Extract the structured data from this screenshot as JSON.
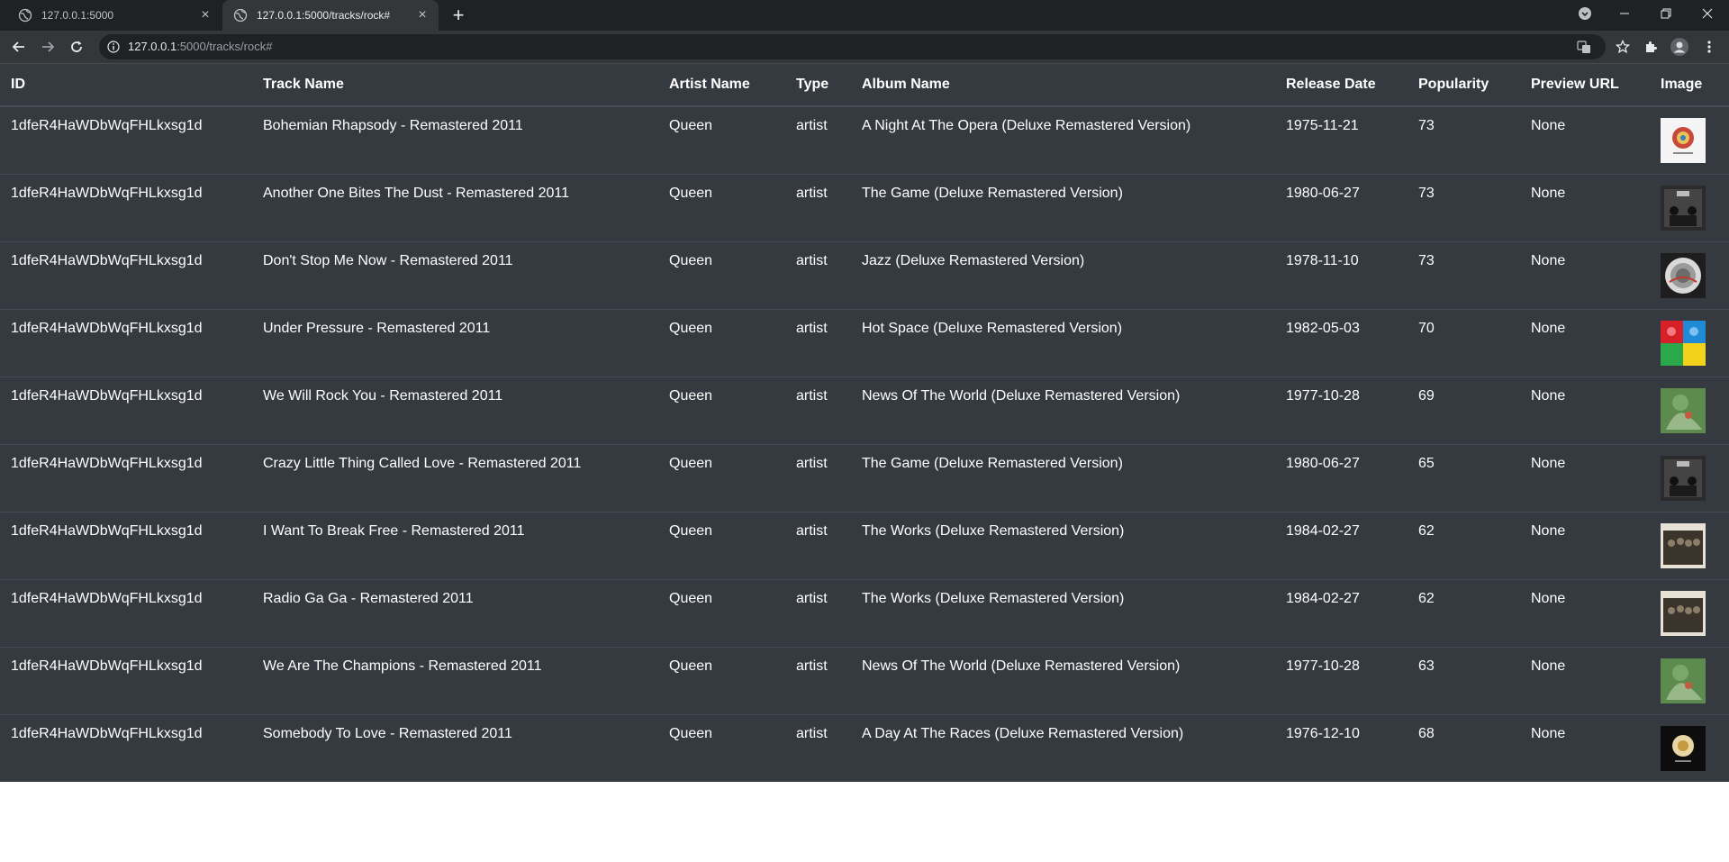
{
  "browser": {
    "tabs": [
      {
        "title": "127.0.0.1:5000",
        "active": false
      },
      {
        "title": "127.0.0.1:5000/tracks/rock#",
        "active": true
      }
    ],
    "address": {
      "host": "127.0.0.1",
      "path": ":5000/tracks/rock#"
    }
  },
  "table": {
    "headers": [
      "ID",
      "Track Name",
      "Artist Name",
      "Type",
      "Album Name",
      "Release Date",
      "Popularity",
      "Preview URL",
      "Image"
    ],
    "rows": [
      {
        "id": "1dfeR4HaWDbWqFHLkxsg1d",
        "track": "Bohemian Rhapsody - Remastered 2011",
        "artist": "Queen",
        "type": "artist",
        "album": "A Night At The Opera (Deluxe Remastered Version)",
        "release": "1975-11-21",
        "popularity": "73",
        "preview": "None",
        "cover": "night-at-the-opera-cover"
      },
      {
        "id": "1dfeR4HaWDbWqFHLkxsg1d",
        "track": "Another One Bites The Dust - Remastered 2011",
        "artist": "Queen",
        "type": "artist",
        "album": "The Game (Deluxe Remastered Version)",
        "release": "1980-06-27",
        "popularity": "73",
        "preview": "None",
        "cover": "the-game-cover"
      },
      {
        "id": "1dfeR4HaWDbWqFHLkxsg1d",
        "track": "Don't Stop Me Now - Remastered 2011",
        "artist": "Queen",
        "type": "artist",
        "album": "Jazz (Deluxe Remastered Version)",
        "release": "1978-11-10",
        "popularity": "73",
        "preview": "None",
        "cover": "jazz-cover"
      },
      {
        "id": "1dfeR4HaWDbWqFHLkxsg1d",
        "track": "Under Pressure - Remastered 2011",
        "artist": "Queen",
        "type": "artist",
        "album": "Hot Space (Deluxe Remastered Version)",
        "release": "1982-05-03",
        "popularity": "70",
        "preview": "None",
        "cover": "hot-space-cover"
      },
      {
        "id": "1dfeR4HaWDbWqFHLkxsg1d",
        "track": "We Will Rock You - Remastered 2011",
        "artist": "Queen",
        "type": "artist",
        "album": "News Of The World (Deluxe Remastered Version)",
        "release": "1977-10-28",
        "popularity": "69",
        "preview": "None",
        "cover": "news-of-the-world-cover"
      },
      {
        "id": "1dfeR4HaWDbWqFHLkxsg1d",
        "track": "Crazy Little Thing Called Love - Remastered 2011",
        "artist": "Queen",
        "type": "artist",
        "album": "The Game (Deluxe Remastered Version)",
        "release": "1980-06-27",
        "popularity": "65",
        "preview": "None",
        "cover": "the-game-cover"
      },
      {
        "id": "1dfeR4HaWDbWqFHLkxsg1d",
        "track": "I Want To Break Free - Remastered 2011",
        "artist": "Queen",
        "type": "artist",
        "album": "The Works (Deluxe Remastered Version)",
        "release": "1984-02-27",
        "popularity": "62",
        "preview": "None",
        "cover": "the-works-cover"
      },
      {
        "id": "1dfeR4HaWDbWqFHLkxsg1d",
        "track": "Radio Ga Ga - Remastered 2011",
        "artist": "Queen",
        "type": "artist",
        "album": "The Works (Deluxe Remastered Version)",
        "release": "1984-02-27",
        "popularity": "62",
        "preview": "None",
        "cover": "the-works-cover"
      },
      {
        "id": "1dfeR4HaWDbWqFHLkxsg1d",
        "track": "We Are The Champions - Remastered 2011",
        "artist": "Queen",
        "type": "artist",
        "album": "News Of The World (Deluxe Remastered Version)",
        "release": "1977-10-28",
        "popularity": "63",
        "preview": "None",
        "cover": "news-of-the-world-cover"
      },
      {
        "id": "1dfeR4HaWDbWqFHLkxsg1d",
        "track": "Somebody To Love - Remastered 2011",
        "artist": "Queen",
        "type": "artist",
        "album": "A Day At The Races (Deluxe Remastered Version)",
        "release": "1976-12-10",
        "popularity": "68",
        "preview": "None",
        "cover": "day-at-the-races-cover"
      }
    ]
  },
  "colors": {
    "tabstrip": "#202124",
    "toolbar": "#35363a",
    "table_bg": "#343a40",
    "row_border": "#454d55",
    "text": "#ffffff"
  }
}
